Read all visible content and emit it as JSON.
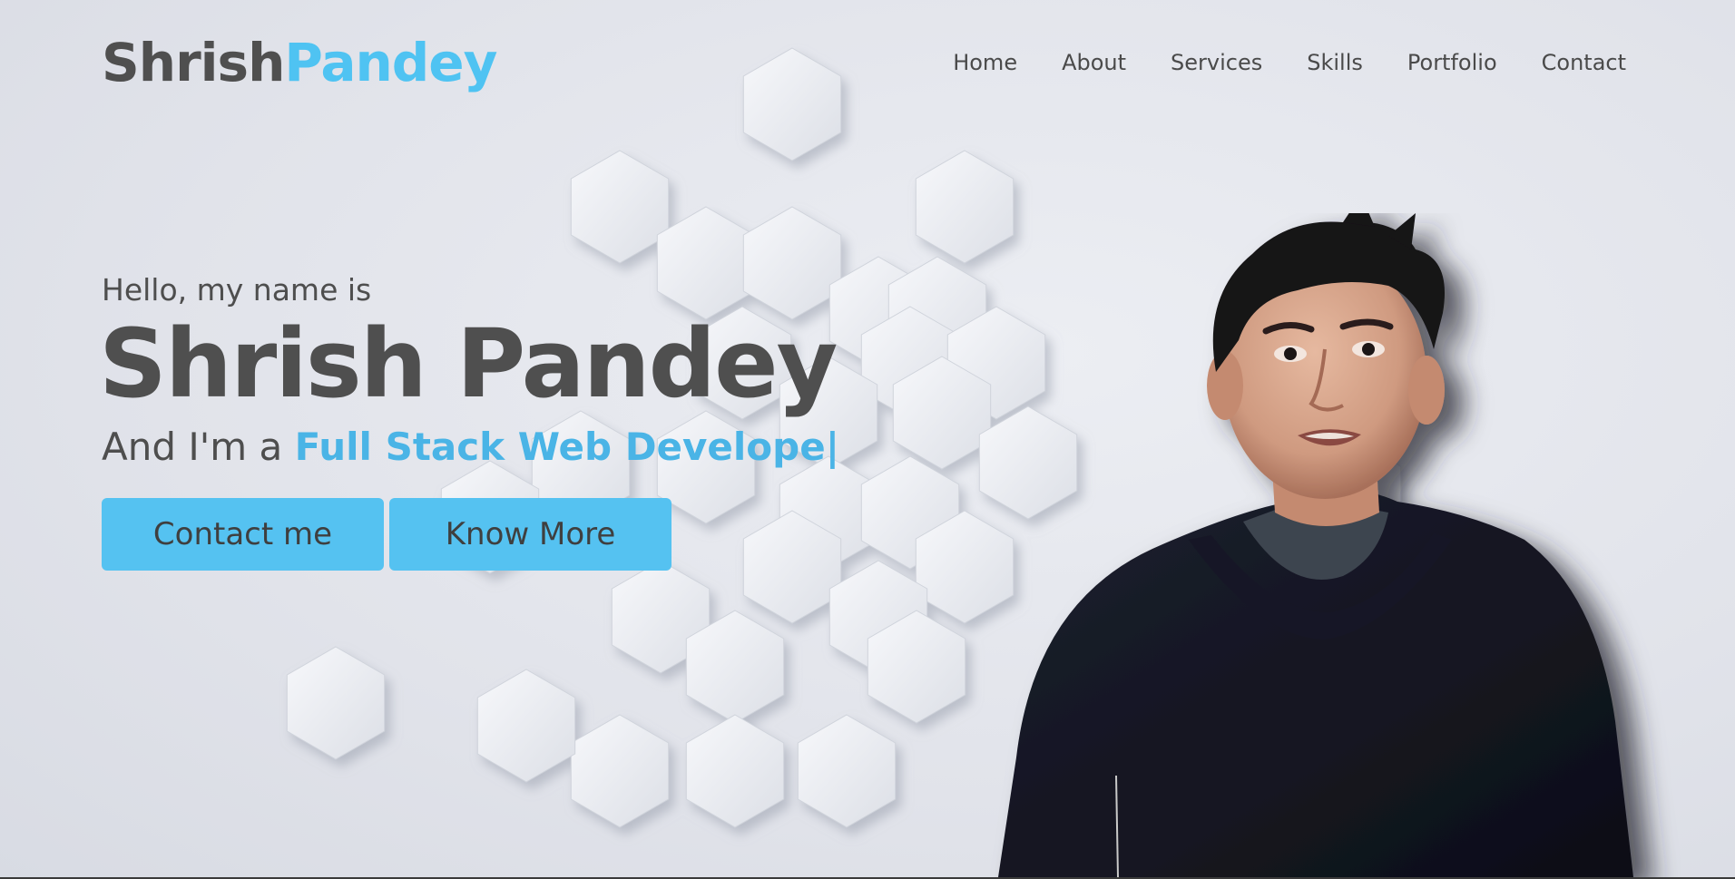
{
  "header": {
    "logo_part1": "Shrish",
    "logo_part2": "Pandey",
    "nav": [
      "Home",
      "About",
      "Services",
      "Skills",
      "Portfolio",
      "Contact"
    ]
  },
  "hero": {
    "greeting": "Hello, my name is",
    "name": "Shrish Pandey",
    "role_prefix": "And I'm a ",
    "role_typed": "Full Stack Web Develope",
    "cursor": "|",
    "primary_button": "Contact me",
    "secondary_button": "Know More"
  },
  "colors": {
    "accent": "#4fc3f2",
    "text": "#4f4f4f",
    "background": "#e4e6ec",
    "button": "#55c2f1"
  }
}
